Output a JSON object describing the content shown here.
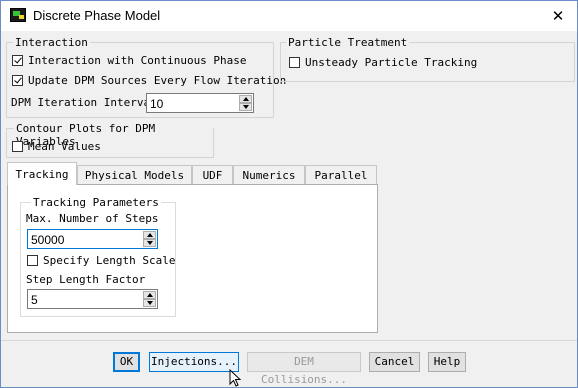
{
  "window": {
    "title": "Discrete Phase Model",
    "close_glyph": "✕",
    "app_icon": "fluent-app-icon"
  },
  "interaction": {
    "title": "Interaction",
    "checkboxes": [
      {
        "label": "Interaction with Continuous Phase",
        "checked": true
      },
      {
        "label": "Update DPM Sources Every Flow Iteration",
        "checked": true
      }
    ],
    "iteration_interval": {
      "label": "DPM Iteration Interval",
      "value": "10"
    }
  },
  "particle_treatment": {
    "title": "Particle Treatment",
    "checkboxes": [
      {
        "label": "Unsteady Particle Tracking",
        "checked": false
      }
    ]
  },
  "contour": {
    "title": "Contour Plots for DPM Variables",
    "checkboxes": [
      {
        "label": "Mean Values",
        "checked": false
      }
    ]
  },
  "tabs": [
    {
      "label": "Tracking",
      "active": true
    },
    {
      "label": "Physical Models",
      "active": false
    },
    {
      "label": "UDF",
      "active": false
    },
    {
      "label": "Numerics",
      "active": false
    },
    {
      "label": "Parallel",
      "active": false
    }
  ],
  "tracking": {
    "title": "Tracking Parameters",
    "max_steps": {
      "label": "Max. Number of Steps",
      "value": "50000"
    },
    "specify_length_scale": {
      "label": "Specify Length Scale",
      "checked": false
    },
    "step_length_factor": {
      "label": "Step Length Factor",
      "value": "5"
    }
  },
  "buttons": {
    "ok": "OK",
    "injections": "Injections...",
    "dem": "DEM Collisions...",
    "cancel": "Cancel",
    "help": "Help"
  }
}
